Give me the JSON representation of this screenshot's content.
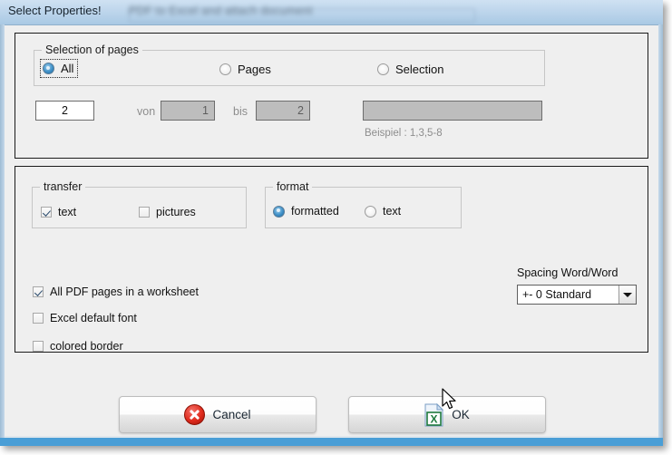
{
  "window": {
    "title": "Select Properties!",
    "background_text": "PDF to Excel and attach document",
    "accent_color": "#4a9ed6",
    "titlebar_color": "#bed6ec"
  },
  "pages_panel": {
    "group_legend": "Selection of pages",
    "radios": [
      {
        "label": "All",
        "selected": true,
        "focused": true
      },
      {
        "label": "Pages",
        "selected": false,
        "focused": false
      },
      {
        "label": "Selection",
        "selected": false,
        "focused": false
      }
    ],
    "count_input": {
      "value": "2",
      "enabled": true
    },
    "from_label": "von",
    "from_input": {
      "value": "1",
      "enabled": false
    },
    "to_label": "bis",
    "to_input": {
      "value": "2",
      "enabled": false
    },
    "selection_input": {
      "value": "",
      "enabled": false
    },
    "hint": "Beispiel : 1,3,5-8"
  },
  "options_panel": {
    "transfer": {
      "legend": "transfer",
      "items": [
        {
          "label": "text",
          "checked": true
        },
        {
          "label": "pictures",
          "checked": false
        }
      ]
    },
    "format": {
      "legend": "format",
      "items": [
        {
          "label": "formatted",
          "selected": true
        },
        {
          "label": "text",
          "selected": false
        }
      ]
    },
    "checkboxes": [
      {
        "label": "All PDF pages in a worksheet",
        "checked": true
      },
      {
        "label": "Excel default font",
        "checked": false
      },
      {
        "label": "colored border",
        "checked": false
      }
    ],
    "spacing": {
      "label": "Spacing Word/Word",
      "value": "+- 0 Standard",
      "options": [
        "+- 0 Standard"
      ]
    }
  },
  "buttons": {
    "cancel": {
      "label": "Cancel",
      "icon": "cancel-circle-icon"
    },
    "ok": {
      "label": "OK",
      "icon": "excel-document-icon"
    }
  },
  "cursor": {
    "type": "arrow-pointer"
  }
}
